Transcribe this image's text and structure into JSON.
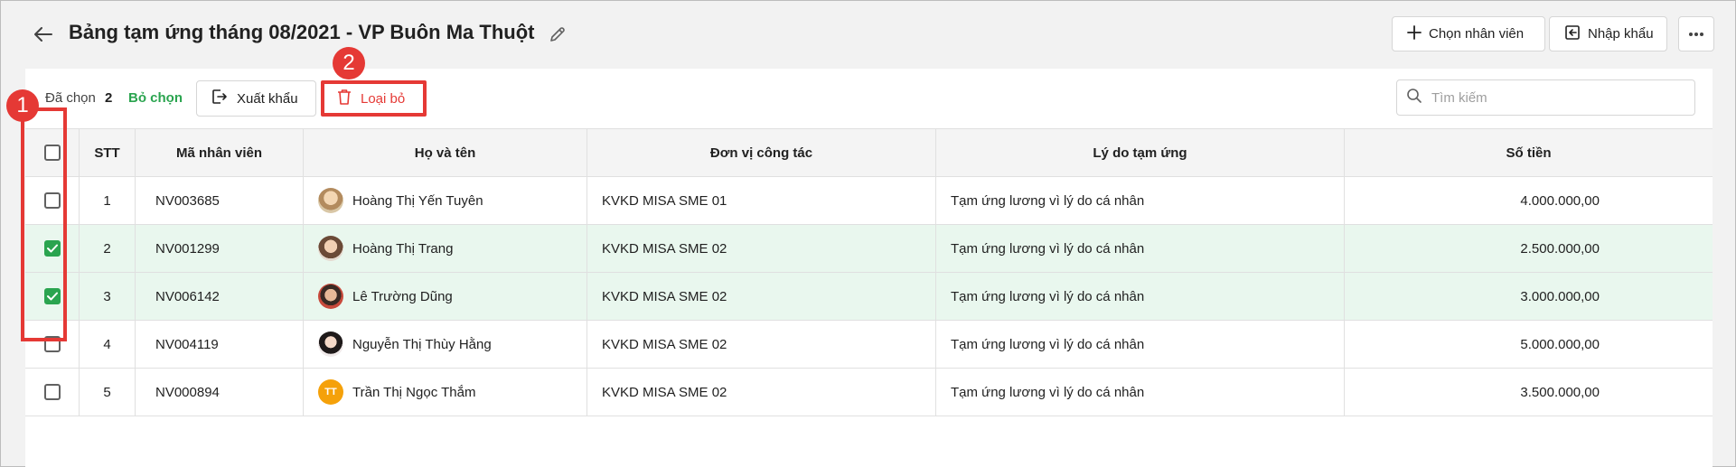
{
  "header": {
    "title": "Bảng tạm ứng tháng 08/2021 - VP Buôn Ma Thuột",
    "choose_employee_label": "Chọn nhân viên",
    "import_label": "Nhập khẩu"
  },
  "toolbar": {
    "selected_label": "Đã chọn",
    "selected_count": "2",
    "deselect_label": "Bỏ chọn",
    "export_label": "Xuất khẩu",
    "remove_label": "Loại bỏ",
    "search_placeholder": "Tìm kiếm"
  },
  "table": {
    "columns": [
      "STT",
      "Mã nhân viên",
      "Họ và tên",
      "Đơn vị công tác",
      "Lý do tạm ứng",
      "Số tiền"
    ],
    "rows": [
      {
        "stt": "1",
        "code": "NV003685",
        "name": "Hoàng Thị Yến Tuyên",
        "unit": "KVKD MISA SME 01",
        "reason": "Tạm ứng lương vì lý do cá nhân",
        "amount": "4.000.000,00",
        "checked": false,
        "avatar": ""
      },
      {
        "stt": "2",
        "code": "NV001299",
        "name": "Hoàng Thị Trang",
        "unit": "KVKD MISA SME 02",
        "reason": "Tạm ứng lương vì lý do cá nhân",
        "amount": "2.500.000,00",
        "checked": true,
        "avatar": ""
      },
      {
        "stt": "3",
        "code": "NV006142",
        "name": "Lê Trường Dũng",
        "unit": "KVKD MISA SME 02",
        "reason": "Tạm ứng lương vì lý do cá nhân",
        "amount": "3.000.000,00",
        "checked": true,
        "avatar": ""
      },
      {
        "stt": "4",
        "code": "NV004119",
        "name": "Nguyễn Thị Thùy Hằng",
        "unit": "KVKD MISA SME 02",
        "reason": "Tạm ứng lương vì lý do cá nhân",
        "amount": "5.000.000,00",
        "checked": false,
        "avatar": ""
      },
      {
        "stt": "5",
        "code": "NV000894",
        "name": "Trần Thị Ngọc Thắm",
        "unit": "KVKD MISA SME 02",
        "reason": "Tạm ứng lương vì lý do cá nhân",
        "amount": "3.500.000,00",
        "checked": false,
        "avatar": "TT"
      }
    ]
  },
  "annotations": {
    "marker_1": "1",
    "marker_2": "2"
  },
  "colors": {
    "accent_green": "#2aa44f",
    "danger_red": "#e53935",
    "selected_row": "#e9f7ee"
  }
}
